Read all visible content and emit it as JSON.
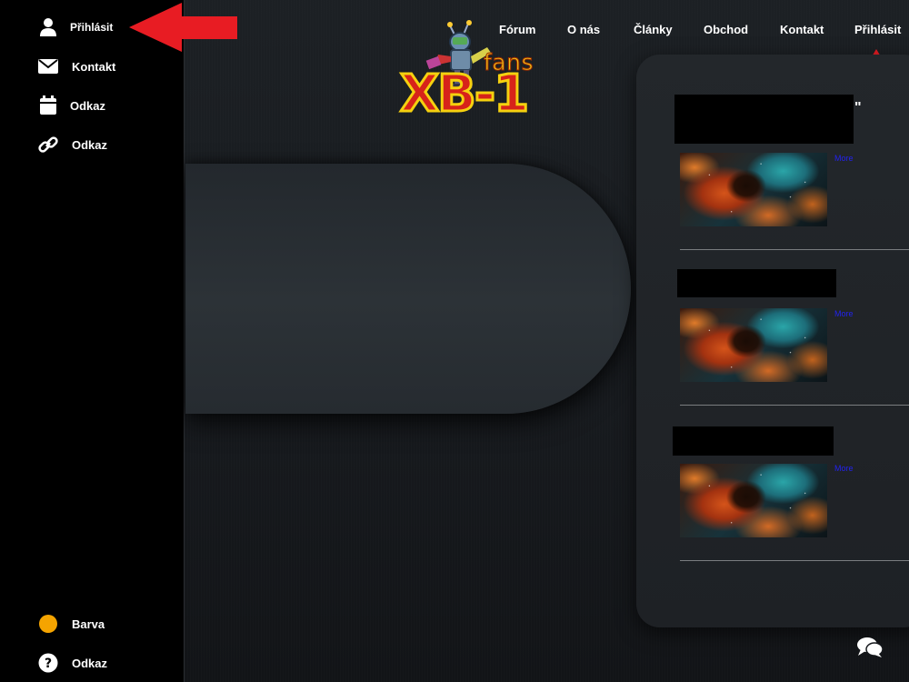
{
  "sidebar": {
    "top_items": [
      {
        "label": "Přihlásit",
        "icon": "user-icon"
      },
      {
        "label": "Kontakt",
        "icon": "envelope-icon"
      },
      {
        "label": "Odkaz",
        "icon": "calendar-icon"
      },
      {
        "label": "Odkaz",
        "icon": "link-icon"
      }
    ],
    "bottom_items": [
      {
        "label": "Barva",
        "icon": "color-dot-icon",
        "color": "#f5a400"
      },
      {
        "label": "Odkaz",
        "icon": "question-circle-icon"
      }
    ]
  },
  "nav": {
    "items": [
      "Fórum",
      "O nás",
      "Články",
      "Obchod",
      "Kontakt",
      "Přihlásit"
    ]
  },
  "logo": {
    "word_top": "fans",
    "word_main": "XB-1"
  },
  "articles": [
    {
      "more_label": "More"
    },
    {
      "more_label": "More"
    },
    {
      "more_label": "More"
    }
  ],
  "colors": {
    "arrow": "#e81c23",
    "more_link": "#2222ee",
    "sidebar_bg": "#000000",
    "accent_yellow": "#f5a400"
  }
}
